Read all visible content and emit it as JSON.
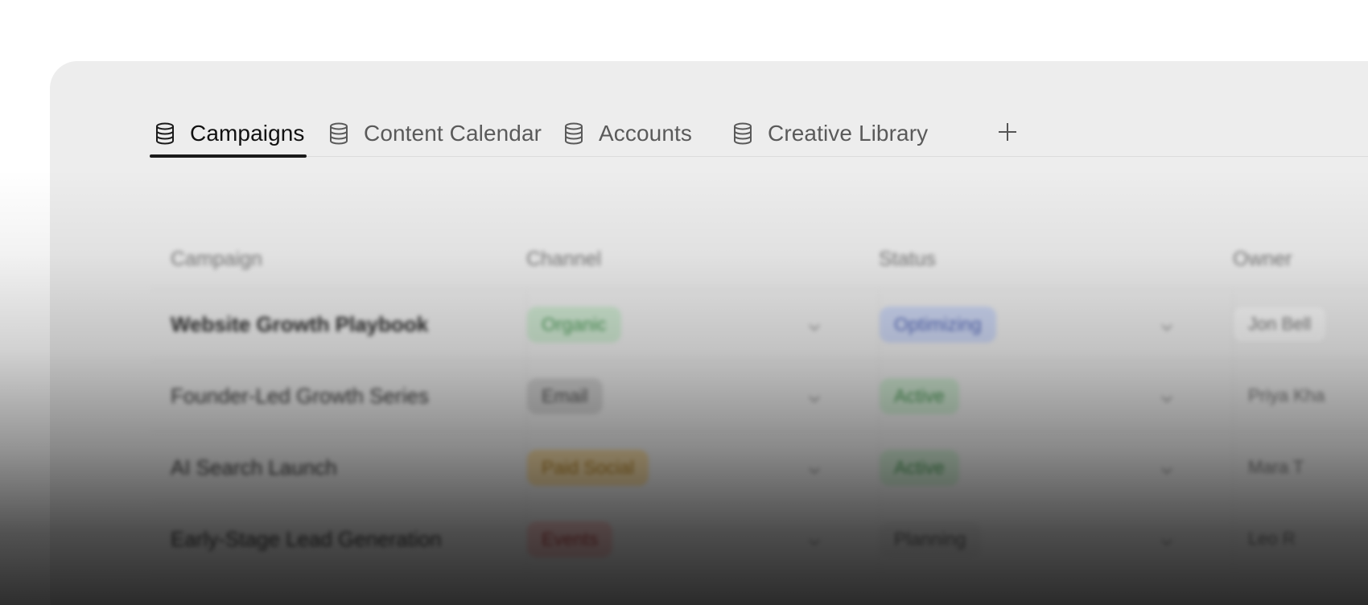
{
  "tabs": [
    {
      "label": "Campaigns",
      "icon": "database-icon",
      "active": true
    },
    {
      "label": "Content Calendar",
      "icon": "database-icon",
      "active": false
    },
    {
      "label": "Accounts",
      "icon": "database-icon",
      "active": false
    },
    {
      "label": "Creative Library",
      "icon": "database-icon",
      "active": false
    }
  ],
  "add_tab_icon": "plus-icon",
  "table": {
    "columns": [
      "Campaign",
      "Channel",
      "Status",
      "Owner"
    ],
    "rows": [
      {
        "campaign": "Website Growth Playbook",
        "channel": "Organic",
        "status": "Optimizing",
        "owner": "Jon Bell"
      },
      {
        "campaign": "Founder-Led Growth Series",
        "channel": "Email",
        "status": "Active",
        "owner": "Priya Kha"
      },
      {
        "campaign": "AI Search Launch",
        "channel": "Paid Social",
        "status": "Active",
        "owner": "Mara T"
      },
      {
        "campaign": "Early-Stage Lead Generation",
        "channel": "Events",
        "status": "Planning",
        "owner": "Leo R"
      }
    ]
  },
  "colors": {
    "organic_bg": "#cfe8d2",
    "organic_fg": "#4f9a5a",
    "email_bg": "#d2d2d2",
    "email_fg": "#555555",
    "paid_bg": "#f2d9a6",
    "paid_fg": "#b38327",
    "events_bg": "#f1c7c7",
    "events_fg": "#b34848",
    "optimizing_bg": "#cdd7f3",
    "optimizing_fg": "#5669b8",
    "active_bg": "#cfe8d2",
    "active_fg": "#4f9a5a",
    "planning_bg": "#e4e4e4",
    "planning_fg": "#666666"
  }
}
